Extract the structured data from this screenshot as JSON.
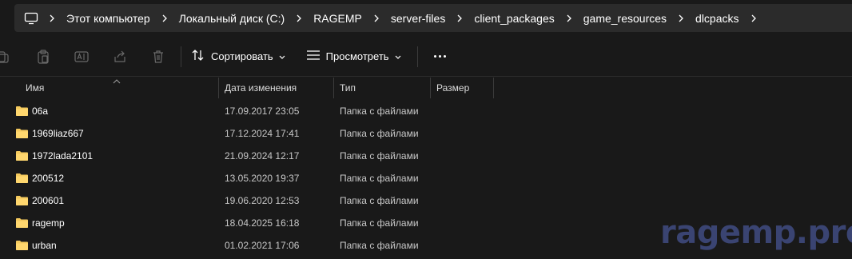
{
  "breadcrumb": {
    "items": [
      {
        "label": "Этот компьютер"
      },
      {
        "label": "Локальный диск (C:)"
      },
      {
        "label": "RAGEMP"
      },
      {
        "label": "server-files"
      },
      {
        "label": "client_packages"
      },
      {
        "label": "game_resources"
      },
      {
        "label": "dlcpacks"
      }
    ]
  },
  "toolbar": {
    "sort_label": "Сортировать",
    "view_label": "Просмотреть"
  },
  "columns": {
    "name": "Имя",
    "date": "Дата изменения",
    "type": "Тип",
    "size": "Размер"
  },
  "files": [
    {
      "name": "06a",
      "date": "17.09.2017 23:05",
      "type": "Папка с файлами"
    },
    {
      "name": "1969liaz667",
      "date": "17.12.2024 17:41",
      "type": "Папка с файлами"
    },
    {
      "name": "1972lada2101",
      "date": "21.09.2024 12:17",
      "type": "Папка с файлами"
    },
    {
      "name": "200512",
      "date": "13.05.2020 19:37",
      "type": "Папка с файлами"
    },
    {
      "name": "200601",
      "date": "19.06.2020 12:53",
      "type": "Папка с файлами"
    },
    {
      "name": "ragemp",
      "date": "18.04.2025 16:18",
      "type": "Папка с файлами"
    },
    {
      "name": "urban",
      "date": "01.02.2021 17:06",
      "type": "Папка с файлами"
    }
  ],
  "watermark": "ragemp.pro",
  "colors": {
    "background": "#191919",
    "addressbar": "#2b2b2b",
    "folder": "#f4c95d",
    "watermark": "#3a4472"
  }
}
